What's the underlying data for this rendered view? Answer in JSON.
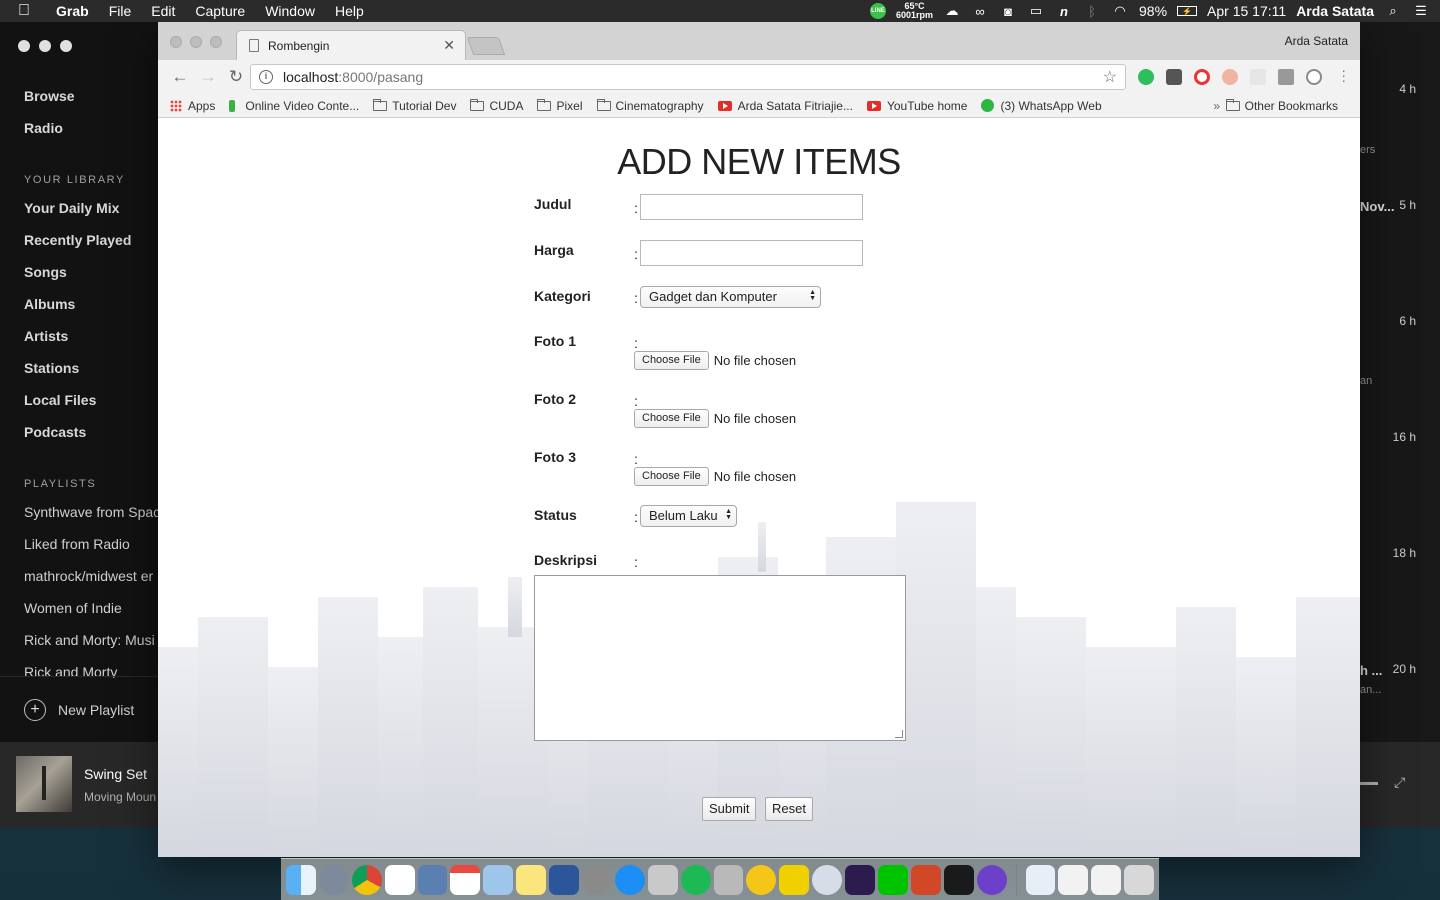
{
  "menubar": {
    "app_name": "Grab",
    "menus": [
      "File",
      "Edit",
      "Capture",
      "Window",
      "Help"
    ],
    "cpu_temp": "65°C",
    "fan_speed": "6001rpm",
    "battery": "98%",
    "datetime": "Apr 15  17:11",
    "user": "Arda Satata"
  },
  "spotify": {
    "nav": [
      "Browse",
      "Radio"
    ],
    "library_heading": "YOUR LIBRARY",
    "library": [
      "Your Daily Mix",
      "Recently Played",
      "Songs",
      "Albums",
      "Artists",
      "Stations",
      "Local Files",
      "Podcasts"
    ],
    "playlists_heading": "PLAYLISTS",
    "playlists": [
      "Synthwave from Spac",
      "Liked from Radio",
      "mathrock/midwest er",
      "Women of Indie",
      "Rick and Morty: Musi",
      "Rick and Morty"
    ],
    "new_playlist": "New Playlist",
    "now_playing": {
      "track": "Swing Set",
      "artist": "Moving Moun"
    },
    "right_times": [
      "4 h",
      "5 h",
      "6 h",
      "16 h",
      "18 h",
      "20 h"
    ],
    "right_snippets": [
      "ers",
      "Nov...",
      "an",
      "h ...",
      "an..."
    ]
  },
  "browser": {
    "tab_title": "Rombengin",
    "profile": "Arda Satata",
    "url_host": "localhost",
    "url_path": ":8000/pasang",
    "bookmarks": [
      "Apps",
      "Online Video Conte...",
      "Tutorial Dev",
      "CUDA",
      "Pixel",
      "Cinematography",
      "Arda Satata Fitriajie...",
      "YouTube home",
      "(3) WhatsApp Web"
    ],
    "bookmarks_more": "»",
    "other_bookmarks": "Other Bookmarks"
  },
  "form": {
    "heading": "ADD NEW ITEMS",
    "colon": ":",
    "labels": {
      "judul": "Judul",
      "harga": "Harga",
      "kategori": "Kategori",
      "foto1": "Foto 1",
      "foto2": "Foto 2",
      "foto3": "Foto 3",
      "status": "Status",
      "deskripsi": "Deskripsi"
    },
    "kategori_value": "Gadget dan Komputer",
    "status_value": "Belum Laku",
    "choose_file": "Choose File",
    "no_file": "No file chosen",
    "submit": "Submit",
    "reset": "Reset"
  },
  "colors": {
    "accent_green": "#3cb043",
    "youtube_red": "#e52d27",
    "spotify_bg": "#121212"
  }
}
